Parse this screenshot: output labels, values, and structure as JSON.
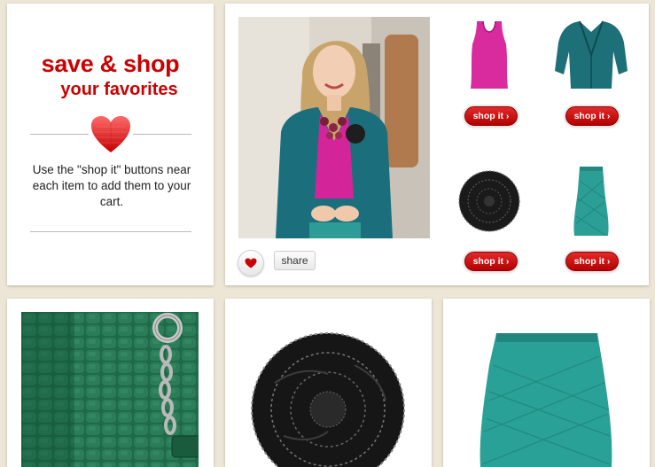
{
  "intro": {
    "title_line1": "save & shop",
    "title_line2": "your favorites",
    "description": "Use the \"shop it\" buttons near each item to add them to your cart."
  },
  "product": {
    "favorite_icon": "heart-icon",
    "share_label": "share",
    "items": [
      {
        "name": "pink-tank-top",
        "shop_label": "shop it ›"
      },
      {
        "name": "teal-blazer",
        "shop_label": "shop it ›"
      },
      {
        "name": "black-flower-brooch",
        "shop_label": "shop it ›"
      },
      {
        "name": "teal-lace-skirt",
        "shop_label": "shop it ›"
      }
    ]
  },
  "colors": {
    "brand_red": "#cc0000",
    "background": "#ede6d6",
    "teal": "#1d6f78",
    "pink": "#d6249a"
  }
}
